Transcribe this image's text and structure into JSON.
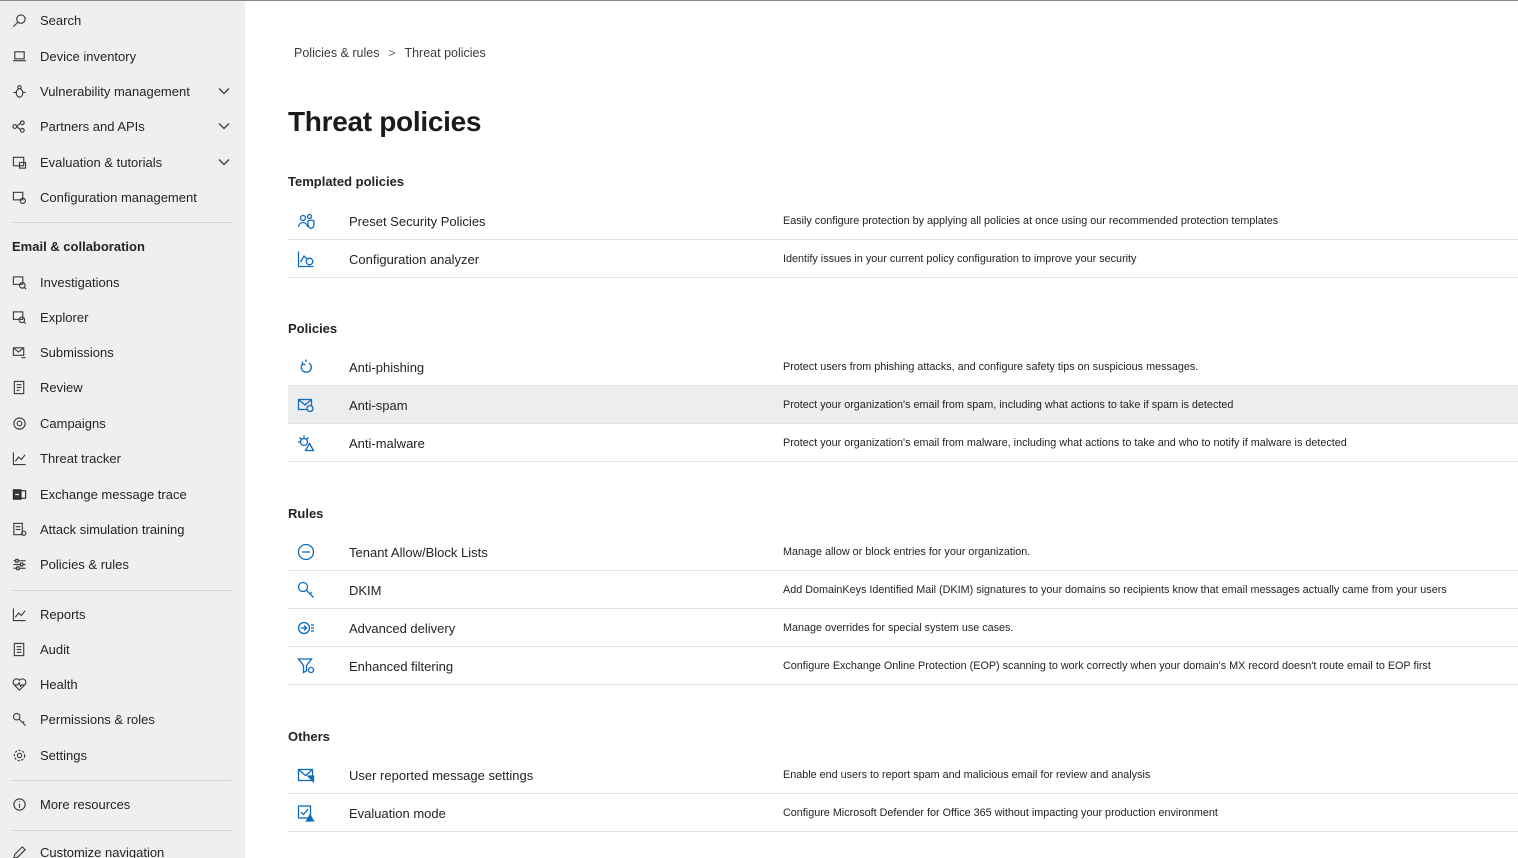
{
  "sidebar": {
    "items": [
      {
        "label": "Search",
        "icon": "search-icon"
      },
      {
        "label": "Device inventory",
        "icon": "laptop-icon"
      },
      {
        "label": "Vulnerability management",
        "icon": "bug-icon",
        "expandable": true
      },
      {
        "label": "Partners and APIs",
        "icon": "share-icon",
        "expandable": true
      },
      {
        "label": "Evaluation & tutorials",
        "icon": "evaluation-icon",
        "expandable": true
      },
      {
        "label": "Configuration management",
        "icon": "config-icon"
      }
    ],
    "email_section_title": "Email & collaboration",
    "email_items": [
      {
        "label": "Investigations",
        "icon": "investigations-icon"
      },
      {
        "label": "Explorer",
        "icon": "explorer-icon"
      },
      {
        "label": "Submissions",
        "icon": "submissions-icon"
      },
      {
        "label": "Review",
        "icon": "review-icon"
      },
      {
        "label": "Campaigns",
        "icon": "target-icon"
      },
      {
        "label": "Threat tracker",
        "icon": "chart-line-icon"
      },
      {
        "label": "Exchange message trace",
        "icon": "exchange-icon"
      },
      {
        "label": "Attack simulation training",
        "icon": "simulation-icon"
      },
      {
        "label": "Policies & rules",
        "icon": "sliders-icon"
      }
    ],
    "bottom_items": [
      {
        "label": "Reports",
        "icon": "chart-line-icon"
      },
      {
        "label": "Audit",
        "icon": "audit-icon"
      },
      {
        "label": "Health",
        "icon": "heart-icon"
      },
      {
        "label": "Permissions & roles",
        "icon": "key-icon"
      },
      {
        "label": "Settings",
        "icon": "gear-icon"
      }
    ],
    "more_resources": {
      "label": "More resources",
      "icon": "info-icon"
    },
    "customize": {
      "label": "Customize navigation",
      "icon": "pencil-icon"
    }
  },
  "breadcrumb": {
    "parent": "Policies & rules",
    "separator": ">",
    "current": "Threat policies"
  },
  "page_title": "Threat policies",
  "sections": {
    "templated": {
      "title": "Templated policies",
      "rows": [
        {
          "name": "Preset Security Policies",
          "desc": "Easily configure protection by applying all policies at once using our recommended protection templates",
          "icon": "people-shield-icon"
        },
        {
          "name": "Configuration analyzer",
          "desc": "Identify issues in your current policy configuration to improve your security",
          "icon": "analyzer-icon"
        }
      ]
    },
    "policies": {
      "title": "Policies",
      "rows": [
        {
          "name": "Anti-phishing",
          "desc": "Protect users from phishing attacks, and configure safety tips on suspicious messages.",
          "icon": "fishhook-icon"
        },
        {
          "name": "Anti-spam",
          "desc": "Protect your organization's email from spam, including what actions to take if spam is detected",
          "icon": "mail-shield-icon",
          "selected": true
        },
        {
          "name": "Anti-malware",
          "desc": "Protect your organization's email from malware, including what actions to take and who to notify if malware is detected",
          "icon": "virus-icon"
        }
      ]
    },
    "rules": {
      "title": "Rules",
      "rows": [
        {
          "name": "Tenant Allow/Block Lists",
          "desc": "Manage allow or block entries for your organization.",
          "icon": "block-icon"
        },
        {
          "name": "DKIM",
          "desc": "Add DomainKeys Identified Mail (DKIM) signatures to your domains so recipients know that email messages actually came from your users",
          "icon": "key-search-icon"
        },
        {
          "name": "Advanced delivery",
          "desc": "Manage overrides for special system use cases.",
          "icon": "delivery-icon"
        },
        {
          "name": "Enhanced filtering",
          "desc": "Configure Exchange Online Protection (EOP) scanning to work correctly when your domain's MX record doesn't route email to EOP first",
          "icon": "filter-icon"
        }
      ]
    },
    "others": {
      "title": "Others",
      "rows": [
        {
          "name": "User reported message settings",
          "desc": "Enable end users to report spam and malicious email for review and analysis",
          "icon": "report-mail-icon"
        },
        {
          "name": "Evaluation mode",
          "desc": "Configure Microsoft Defender for Office 365 without impacting your production environment",
          "icon": "evaluation-check-icon"
        }
      ]
    }
  },
  "colors": {
    "sidebar_bg": "#efefef",
    "accent": "#0f6cbd",
    "selected_row": "#ededed"
  }
}
